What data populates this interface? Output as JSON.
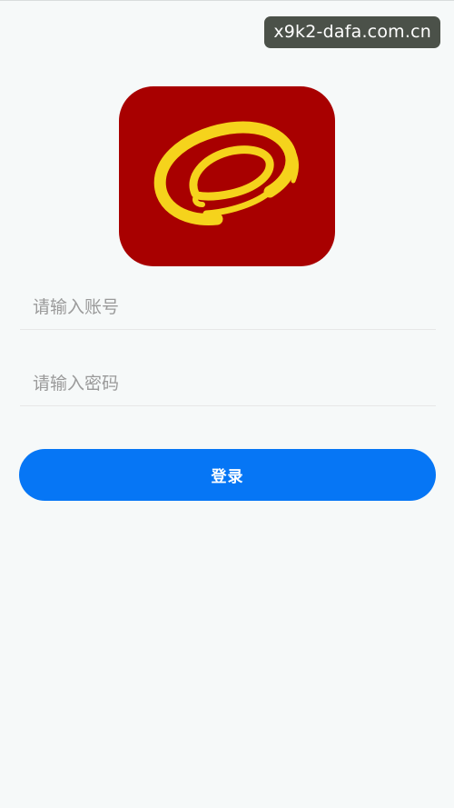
{
  "watermark": {
    "text": "x9k2-dafa.com.cn"
  },
  "logo": {
    "background_color": "#a80000",
    "ring_color": "#f5d31c",
    "icon": "ring-swirl-logo-icon"
  },
  "login_form": {
    "account_placeholder": "请输入账号",
    "password_placeholder": "请输入密码",
    "submit_label": "登录",
    "submit_color": "#0676f5"
  }
}
